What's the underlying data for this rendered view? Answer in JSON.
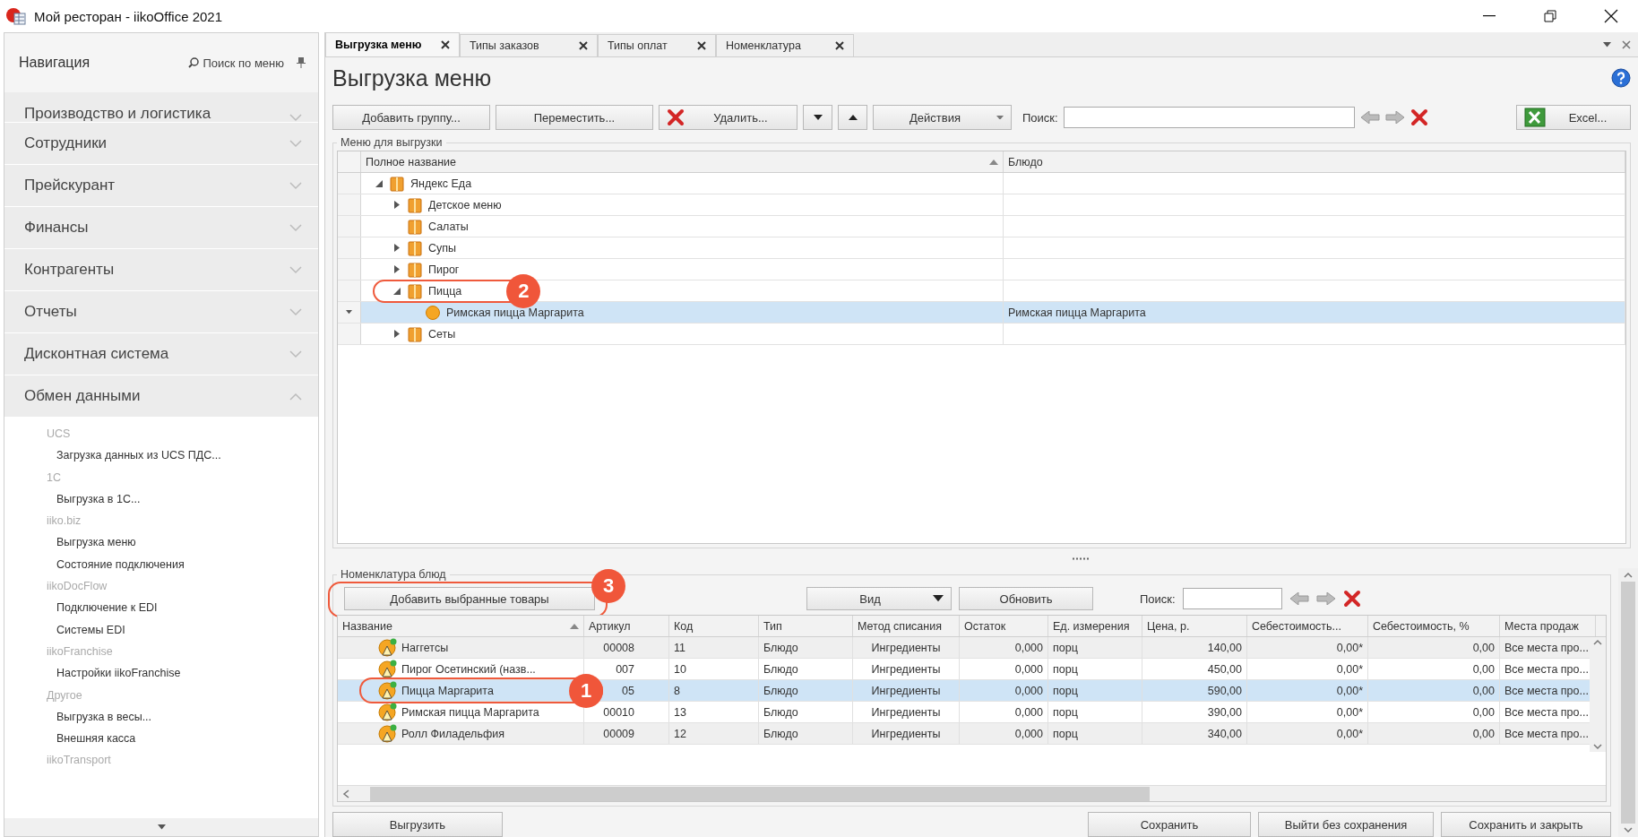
{
  "window": {
    "title": "Мой ресторан - iikoOffice 2021"
  },
  "navigation": {
    "title": "Навигация",
    "search": "Поиск по меню",
    "sections": [
      {
        "label": "Производство и логистика",
        "expanded": false
      },
      {
        "label": "Сотрудники",
        "expanded": false
      },
      {
        "label": "Прейскурант",
        "expanded": false
      },
      {
        "label": "Финансы",
        "expanded": false
      },
      {
        "label": "Контрагенты",
        "expanded": false
      },
      {
        "label": "Отчеты",
        "expanded": false
      },
      {
        "label": "Дисконтная система",
        "expanded": false
      },
      {
        "label": "Обмен данными",
        "expanded": true
      }
    ],
    "groups": [
      {
        "title": "UCS",
        "items": [
          "Загрузка данных из UCS ПДС..."
        ]
      },
      {
        "title": "1C",
        "items": [
          "Выгрузка в 1С..."
        ]
      },
      {
        "title": "iiko.biz",
        "items": [
          "Выгрузка меню",
          "Состояние подключения"
        ]
      },
      {
        "title": "iikoDocFlow",
        "items": [
          "Подключение к EDI",
          "Системы EDI"
        ]
      },
      {
        "title": "iikoFranchise",
        "items": [
          "Настройки iikoFranchise"
        ]
      },
      {
        "title": "Другое",
        "items": [
          "Выгрузка в весы...",
          "Внешняя касса"
        ]
      },
      {
        "title": "iikoTransport"
      }
    ]
  },
  "tabs": [
    {
      "label": "Выгрузка меню",
      "selected": true
    },
    {
      "label": "Типы заказов",
      "selected": false
    },
    {
      "label": "Типы оплат",
      "selected": false
    },
    {
      "label": "Номенклатура",
      "selected": false
    }
  ],
  "page": {
    "title": "Выгрузка меню"
  },
  "toolbar": {
    "add_group": "Добавить группу...",
    "move": "Переместить...",
    "delete": "Удалить...",
    "actions": "Действия",
    "search_label": "Поиск:",
    "excel": "Excel..."
  },
  "menu_tree": {
    "title": "Меню для выгрузки",
    "columns": [
      "Полное название",
      "Блюдо"
    ],
    "nodes": [
      {
        "name": "Яндекс Еда",
        "kind": "folder",
        "expanded": true,
        "selected": false,
        "children": [
          {
            "name": "Детское меню",
            "kind": "folder",
            "expanded": false,
            "selected": false
          },
          {
            "name": "Салаты",
            "kind": "folder",
            "selected": false
          },
          {
            "name": "Супы",
            "kind": "folder",
            "expanded": false,
            "selected": false
          },
          {
            "name": "Пирог",
            "kind": "folder",
            "expanded": false,
            "selected": false
          },
          {
            "name": "Пицца",
            "kind": "folder",
            "expanded": true,
            "selected": false,
            "marker": "2",
            "children": [
              {
                "name": "Римская пицца Маргарита",
                "kind": "dish",
                "dish": "Римская пицца Маргарита",
                "selected": true
              }
            ]
          },
          {
            "name": "Сеты",
            "kind": "folder",
            "expanded": false,
            "selected": false
          }
        ]
      }
    ]
  },
  "nomenclature": {
    "title": "Номенклатура блюд",
    "add_selected": "Добавить выбранные товары",
    "add_marker": "3",
    "view": "Вид",
    "refresh": "Обновить",
    "search_label": "Поиск:",
    "columns": [
      "Название",
      "Артикул",
      "Код",
      "Тип",
      "Метод списания",
      "Остаток",
      "Ед. измерения",
      "Цена, р.",
      "Себестоимость...",
      "Себестоимость, %",
      "Места продаж"
    ],
    "rows": [
      {
        "selected": false,
        "cells": [
          "Наггетсы",
          "00008",
          "11",
          "Блюдо",
          "Ингредиенты",
          "0,000",
          "порц",
          "140,00",
          "0,00*",
          "0,00",
          "Все места про..."
        ]
      },
      {
        "selected": false,
        "cells": [
          "Пирог Осетинский (назв...",
          "007",
          "10",
          "Блюдо",
          "Ингредиенты",
          "0,000",
          "порц",
          "450,00",
          "0,00*",
          "0,00",
          "Все места про..."
        ]
      },
      {
        "selected": true,
        "marker": "1",
        "cells": [
          "Пицца Маргарита",
          "05",
          "8",
          "Блюдо",
          "Ингредиенты",
          "0,000",
          "порц",
          "590,00",
          "0,00*",
          "0,00",
          "Все места про..."
        ]
      },
      {
        "selected": false,
        "cells": [
          "Римская пицца Маргарита",
          "00010",
          "13",
          "Блюдо",
          "Ингредиенты",
          "0,000",
          "порц",
          "390,00",
          "0,00*",
          "0,00",
          "Все места про..."
        ]
      },
      {
        "selected": false,
        "cells": [
          "Ролл Филадельфия",
          "00009",
          "12",
          "Блюдо",
          "Ингредиенты",
          "0,000",
          "порц",
          "340,00",
          "0,00*",
          "0,00",
          "Все места про..."
        ]
      }
    ]
  },
  "footer": {
    "export": "Выгрузить",
    "buttons": [
      "Сохранить",
      "Выйти без сохранения",
      "Сохранить и закрыть"
    ]
  }
}
